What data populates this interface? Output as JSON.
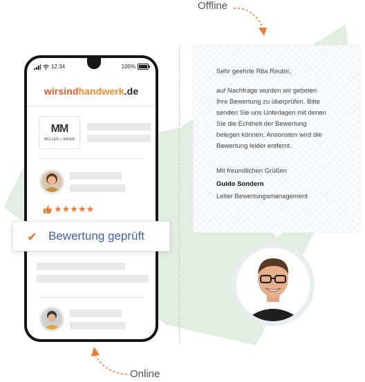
{
  "annotations": {
    "offline": "Offline",
    "online": "Online"
  },
  "phone": {
    "status_time": "12:34",
    "battery_percent": "100%",
    "battery_level": 1.0,
    "site_logo": {
      "part1": "wir",
      "part2": "sind",
      "part3": "handwerk",
      "part4": ".de"
    },
    "company_logo": {
      "mark": "MM",
      "name": "MÜLLER + MAIER"
    },
    "rating": {
      "stars": 5,
      "max": 5
    }
  },
  "badge": {
    "label": "Bewertung geprüft"
  },
  "letter": {
    "greeting": "Sehr geehrte Rita Reuter,",
    "body_1": "auf Nachfrage wurden wir gebeten",
    "body_2": "Ihre Bewertung zu überprüfen. Bitte",
    "body_3": "senden Sie uns Unterlagen mit denen",
    "body_4": "Sie die Echtheit der Bewertung",
    "body_5": "belegen können. Ansonsten wird die",
    "body_6": "Bewertung leider entfernt.",
    "closing": "Mit freundlichen Grüßen",
    "sender_name": "Guido Sondern",
    "sender_title": "Leiter Bewertungsmanagement"
  },
  "colors": {
    "accent_orange": "#f07a2f",
    "badge_blue": "#3e5fb0",
    "bg_green": "#dbe9dc"
  },
  "icons": [
    "signal-icon",
    "wifi-icon",
    "battery-icon",
    "thumbs-up-icon",
    "star-icon",
    "checkmark-icon",
    "dashed-arrow-icon"
  ]
}
